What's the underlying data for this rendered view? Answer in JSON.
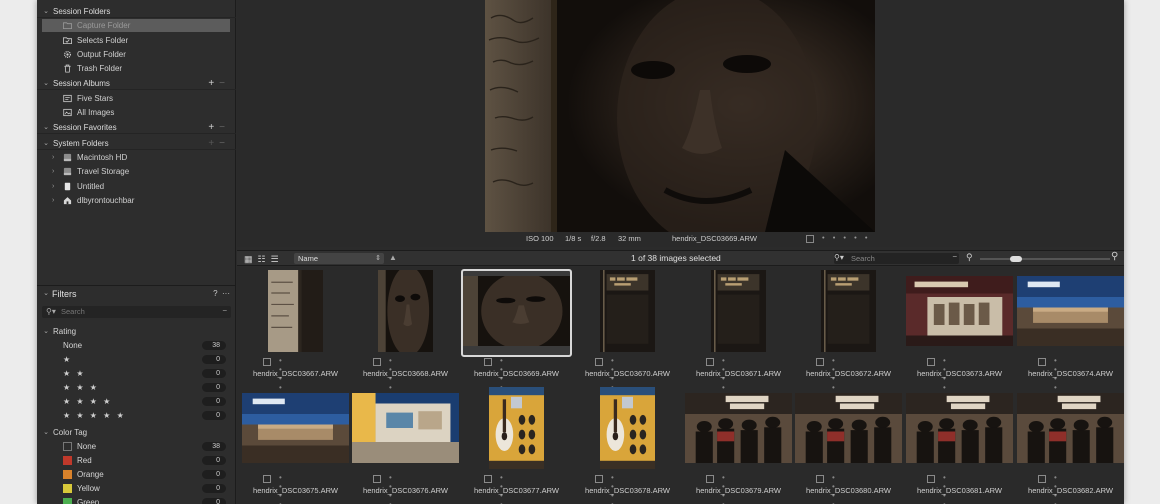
{
  "sidebar": {
    "sections": [
      {
        "label": "Session Folders",
        "items": [
          {
            "label": "Capture Folder",
            "icon": "folder-icon"
          },
          {
            "label": "Selects Folder",
            "icon": "selects-folder-icon"
          },
          {
            "label": "Output Folder",
            "icon": "gear-icon"
          },
          {
            "label": "Trash Folder",
            "icon": "trash-icon"
          }
        ]
      },
      {
        "label": "Session Albums",
        "items": [
          {
            "label": "Five Stars",
            "icon": "smart-album-icon"
          },
          {
            "label": "All Images",
            "icon": "album-icon"
          }
        ]
      },
      {
        "label": "Session Favorites",
        "items": []
      },
      {
        "label": "System Folders",
        "items": [
          {
            "label": "Macintosh HD",
            "icon": "hard-drive-icon"
          },
          {
            "label": "Travel Storage",
            "icon": "hard-drive-icon"
          },
          {
            "label": "Untitled",
            "icon": "removable-drive-icon"
          },
          {
            "label": "dlbyrontouchbar",
            "icon": "home-icon"
          }
        ]
      }
    ]
  },
  "filters": {
    "title": "Filters",
    "help": "?",
    "more": "···",
    "search_placeholder": "Search",
    "rating": {
      "label": "Rating",
      "rows": [
        {
          "label": "None",
          "count": "38"
        },
        {
          "label": "★",
          "count": "0"
        },
        {
          "label": "★ ★",
          "count": "0"
        },
        {
          "label": "★ ★ ★",
          "count": "0"
        },
        {
          "label": "★ ★ ★ ★",
          "count": "0"
        },
        {
          "label": "★ ★ ★ ★ ★",
          "count": "0"
        }
      ]
    },
    "color_tag": {
      "label": "Color Tag",
      "rows": [
        {
          "label": "None",
          "count": "38",
          "color": "#2d2d2d"
        },
        {
          "label": "Red",
          "count": "0",
          "color": "#c0392b"
        },
        {
          "label": "Orange",
          "count": "0",
          "color": "#d9822b"
        },
        {
          "label": "Yellow",
          "count": "0",
          "color": "#d8c93a"
        },
        {
          "label": "Green",
          "count": "0",
          "color": "#4caf50"
        }
      ]
    }
  },
  "viewer": {
    "iso": "ISO 100",
    "shutter": "1/8 s",
    "aperture": "f/2.8",
    "focal": "32 mm",
    "filename": "hendrix_DSC03669.ARW",
    "rating_dots": "• • • • •"
  },
  "toolbar": {
    "sort": "Name",
    "selection": "1 of 38 images selected",
    "search_placeholder": "Search",
    "zoom_level": 0.25
  },
  "thumbnails": [
    {
      "filename": "hendrix_DSC03667.ARW",
      "dots": "• • • • •",
      "kind": "paper",
      "orient": "portrait"
    },
    {
      "filename": "hendrix_DSC03668.ARW",
      "dots": "• • • • •",
      "kind": "face",
      "orient": "portrait"
    },
    {
      "filename": "hendrix_DSC03669.ARW",
      "dots": "• • • • •",
      "kind": "face",
      "orient": "landscape",
      "selected": true
    },
    {
      "filename": "hendrix_DSC03670.ARW",
      "dots": "• • • • •",
      "kind": "dark",
      "orient": "portrait"
    },
    {
      "filename": "hendrix_DSC03671.ARW",
      "dots": "• • • • •",
      "kind": "dark",
      "orient": "portrait"
    },
    {
      "filename": "hendrix_DSC03672.ARW",
      "dots": "• • • • •",
      "kind": "dark",
      "orient": "portrait"
    },
    {
      "filename": "hendrix_DSC03673.ARW",
      "dots": "• • • • •",
      "kind": "exhibit",
      "orient": "landscape"
    },
    {
      "filename": "hendrix_DSC03674.ARW",
      "dots": "• • • • •",
      "kind": "room",
      "orient": "landscape"
    },
    {
      "filename": "hendrix_DSC03675.ARW",
      "dots": "• • • • •",
      "kind": "room",
      "orient": "landscape"
    },
    {
      "filename": "hendrix_DSC03676.ARW",
      "dots": "• • • • •",
      "kind": "exhibit2",
      "orient": "landscape"
    },
    {
      "filename": "hendrix_DSC03677.ARW",
      "dots": "• • • • •",
      "kind": "guitar",
      "orient": "portrait"
    },
    {
      "filename": "hendrix_DSC03678.ARW",
      "dots": "• • • • •",
      "kind": "guitar",
      "orient": "portrait"
    },
    {
      "filename": "hendrix_DSC03679.ARW",
      "dots": "• • • • •",
      "kind": "people",
      "orient": "landscape"
    },
    {
      "filename": "hendrix_DSC03680.ARW",
      "dots": "• • • • •",
      "kind": "people",
      "orient": "landscape"
    },
    {
      "filename": "hendrix_DSC03681.ARW",
      "dots": "• • • • •",
      "kind": "people",
      "orient": "landscape"
    },
    {
      "filename": "hendrix_DSC03682.ARW",
      "dots": "• • • • •",
      "kind": "people",
      "orient": "landscape"
    }
  ]
}
